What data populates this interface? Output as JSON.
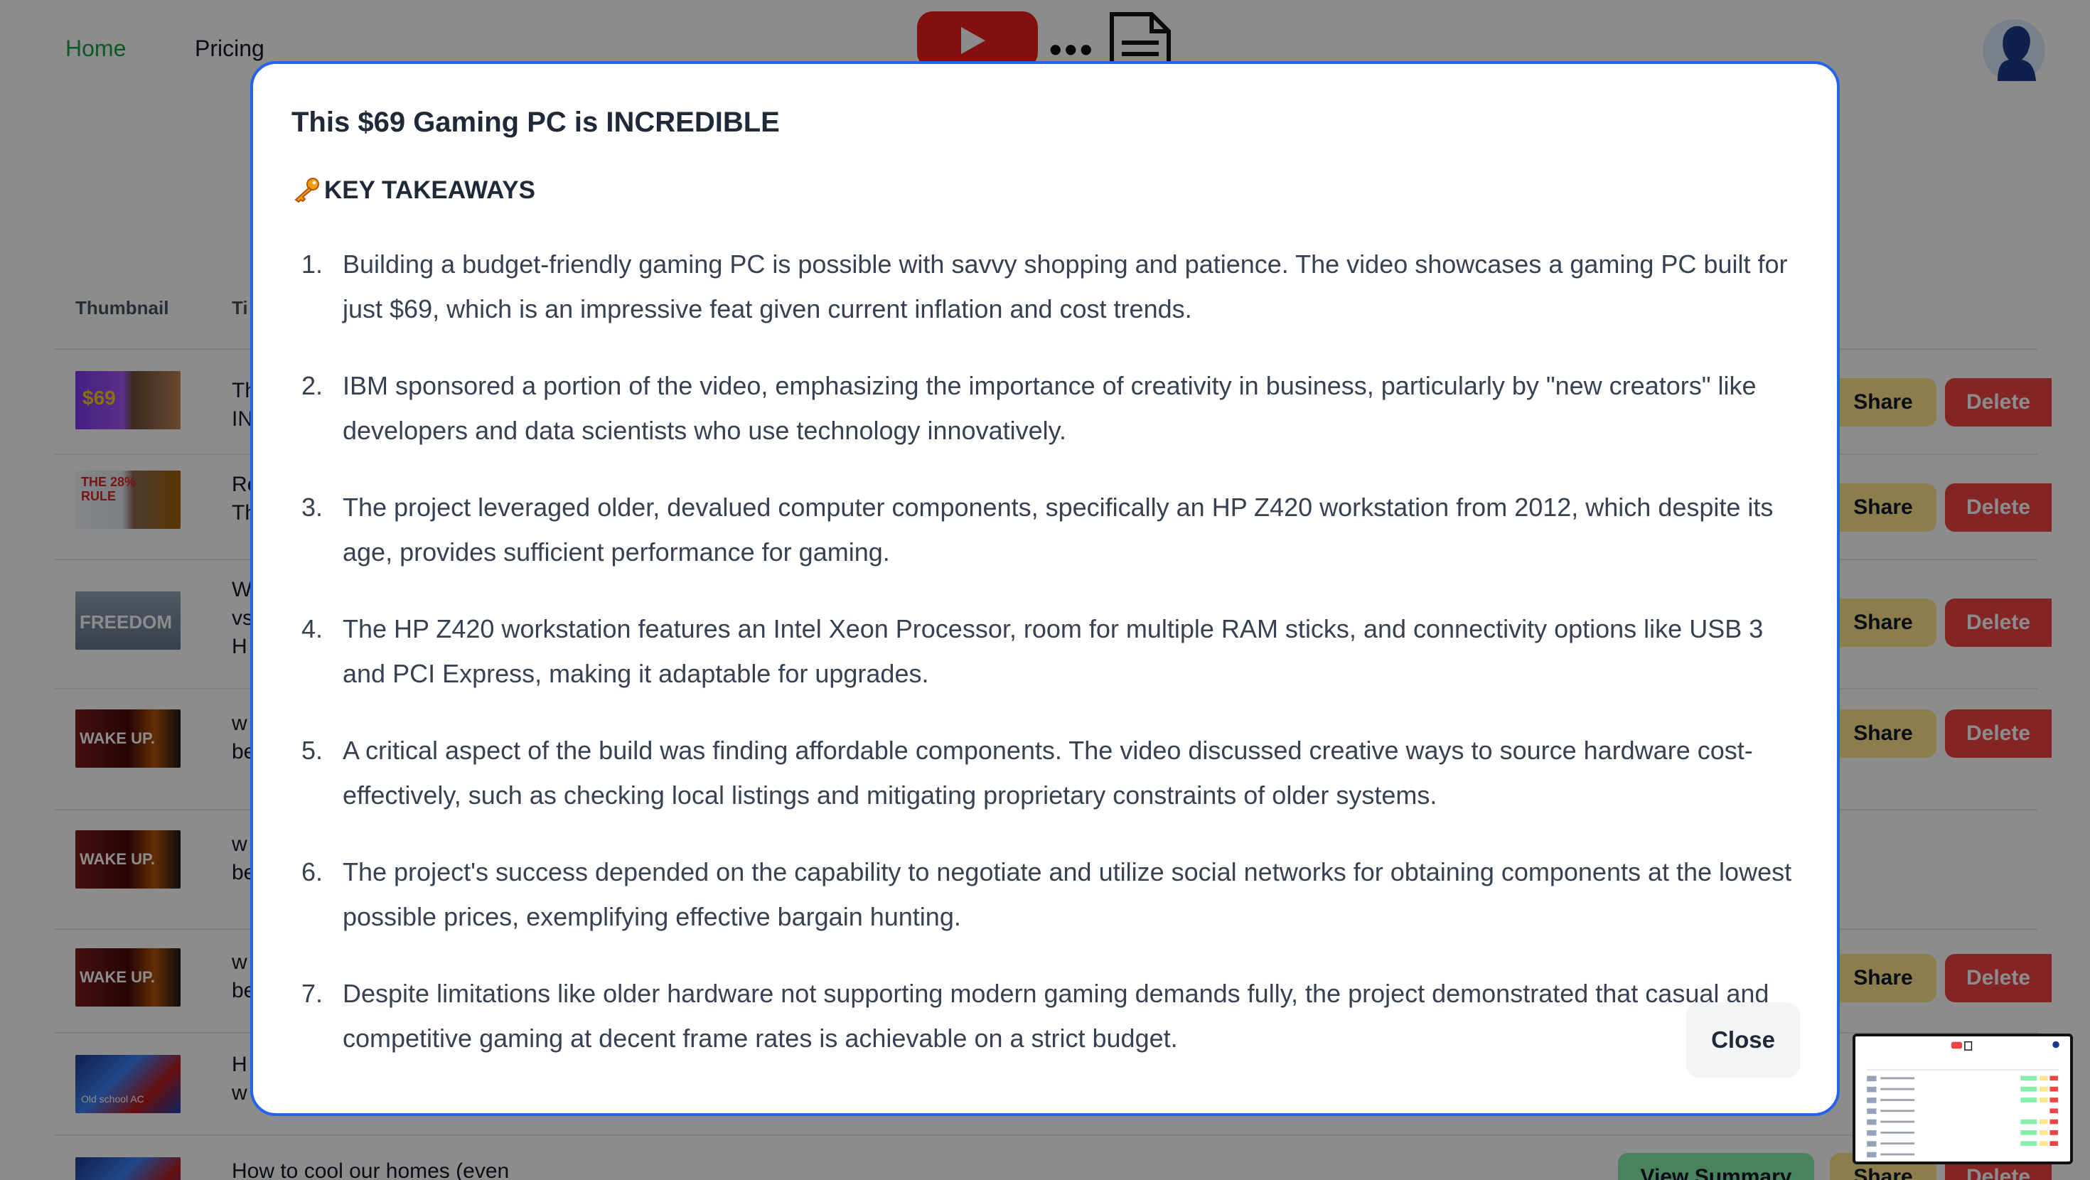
{
  "nav": {
    "home": "Home",
    "pricing": "Pricing"
  },
  "logo": {
    "icon": "youtube-to-document-logo"
  },
  "user": {
    "avatar_icon": "user-silhouette-avatar"
  },
  "table": {
    "headers": {
      "thumbnail": "Thumbnail",
      "title": "Ti"
    },
    "rows": [
      {
        "thumb_text": "$69",
        "title": "Th\nIN"
      },
      {
        "thumb_text": "THE 28% RULE",
        "title": "Re\nTh"
      },
      {
        "thumb_text": "FREEDOM",
        "title": "W\nvs\nH"
      },
      {
        "thumb_text": "WAKE UP.",
        "title": "w\nbe"
      },
      {
        "thumb_text": "WAKE UP.",
        "title": "w\nbe"
      },
      {
        "thumb_text": "WAKE UP.",
        "title": "w\nbe"
      },
      {
        "thumb_text": "Old school AC",
        "title": "H\nw"
      },
      {
        "thumb_text": "",
        "title": "How to cool our homes (even"
      }
    ],
    "share_label": "Share",
    "delete_label": "Delete",
    "view_summary_label": "View Summary"
  },
  "modal": {
    "title": "This $69 Gaming PC is INCREDIBLE",
    "subtitle": "KEY TAKEAWAYS",
    "subtitle_icon": "key-emoji",
    "takeaways": [
      {
        "num": "1.",
        "text": "Building a budget-friendly gaming PC is possible with savvy shopping and patience. The video showcases a gaming PC built for just $69, which is an impressive feat given current inflation and cost trends."
      },
      {
        "num": "2.",
        "text": "IBM sponsored a portion of the video, emphasizing the importance of creativity in business, particularly by \"new creators\" like developers and data scientists who use technology innovatively."
      },
      {
        "num": "3.",
        "text": "The project leveraged older, devalued computer components, specifically an HP Z420 workstation from 2012, which despite its age, provides sufficient performance for gaming."
      },
      {
        "num": "4.",
        "text": "The HP Z420 workstation features an Intel Xeon Processor, room for multiple RAM sticks, and connectivity options like USB 3 and PCI Express, making it adaptable for upgrades."
      },
      {
        "num": "5.",
        "text": "A critical aspect of the build was finding affordable components. The video discussed creative ways to source hardware cost-effectively, such as checking local listings and mitigating proprietary constraints of older systems."
      },
      {
        "num": "6.",
        "text": "The project's success depended on the capability to negotiate and utilize social networks for obtaining components at the lowest possible prices, exemplifying effective bargain hunting."
      },
      {
        "num": "7.",
        "text": "Despite limitations like older hardware not supporting modern gaming demands fully, the project demonstrated that casual and competitive gaming at decent frame rates is achievable on a strict budget."
      }
    ],
    "close_label": "Close"
  },
  "colors": {
    "accent_green": "#16a34a",
    "modal_border": "#2563eb",
    "share_button": "#fde68a",
    "delete_button": "#ef4444",
    "view_summary_button": "#86efac"
  }
}
